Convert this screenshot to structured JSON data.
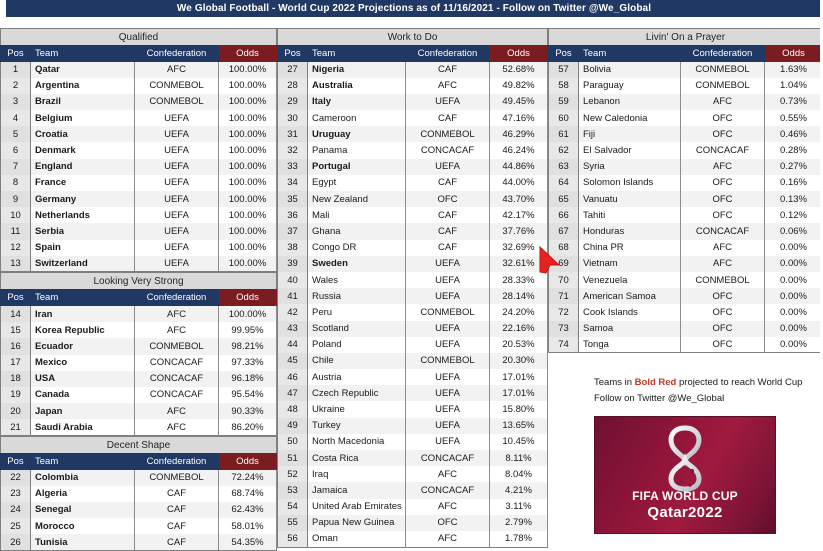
{
  "window": {
    "title": "We Global Football - World Cup 2022 Projections as of 11/16/2021 - Follow on Twitter @We_Global",
    "accent_navy": "#1F3864",
    "accent_red": "#7B1D20",
    "qualify_red": "#C0392B"
  },
  "columns": {
    "headers": {
      "pos": "Pos",
      "team": "Team",
      "confederation": "Confederation",
      "odds": "Odds"
    }
  },
  "sections": [
    {
      "band": "Qualified",
      "column": 1,
      "rows": [
        {
          "pos": "1",
          "team": "Qatar",
          "conf": "AFC",
          "odds": "100.00%",
          "bold": true
        },
        {
          "pos": "2",
          "team": "Argentina",
          "conf": "CONMEBOL",
          "odds": "100.00%",
          "bold": true
        },
        {
          "pos": "3",
          "team": "Brazil",
          "conf": "CONMEBOL",
          "odds": "100.00%",
          "bold": true
        },
        {
          "pos": "4",
          "team": "Belgium",
          "conf": "UEFA",
          "odds": "100.00%",
          "bold": true
        },
        {
          "pos": "5",
          "team": "Croatia",
          "conf": "UEFA",
          "odds": "100.00%",
          "bold": true
        },
        {
          "pos": "6",
          "team": "Denmark",
          "conf": "UEFA",
          "odds": "100.00%",
          "bold": true
        },
        {
          "pos": "7",
          "team": "England",
          "conf": "UEFA",
          "odds": "100.00%",
          "bold": true
        },
        {
          "pos": "8",
          "team": "France",
          "conf": "UEFA",
          "odds": "100.00%",
          "bold": true
        },
        {
          "pos": "9",
          "team": "Germany",
          "conf": "UEFA",
          "odds": "100.00%",
          "bold": true
        },
        {
          "pos": "10",
          "team": "Netherlands",
          "conf": "UEFA",
          "odds": "100.00%",
          "bold": true
        },
        {
          "pos": "11",
          "team": "Serbia",
          "conf": "UEFA",
          "odds": "100.00%",
          "bold": true
        },
        {
          "pos": "12",
          "team": "Spain",
          "conf": "UEFA",
          "odds": "100.00%",
          "bold": true
        },
        {
          "pos": "13",
          "team": "Switzerland",
          "conf": "UEFA",
          "odds": "100.00%",
          "bold": true
        }
      ]
    },
    {
      "band": "Looking Very Strong",
      "column": 1,
      "rows": [
        {
          "pos": "14",
          "team": "Iran",
          "conf": "AFC",
          "odds": "100.00%",
          "bold": true
        },
        {
          "pos": "15",
          "team": "Korea Republic",
          "conf": "AFC",
          "odds": "99.95%",
          "bold": true
        },
        {
          "pos": "16",
          "team": "Ecuador",
          "conf": "CONMEBOL",
          "odds": "98.21%",
          "bold": true
        },
        {
          "pos": "17",
          "team": "Mexico",
          "conf": "CONCACAF",
          "odds": "97.33%",
          "bold": true
        },
        {
          "pos": "18",
          "team": "USA",
          "conf": "CONCACAF",
          "odds": "96.18%",
          "bold": true
        },
        {
          "pos": "19",
          "team": "Canada",
          "conf": "CONCACAF",
          "odds": "95.54%",
          "bold": true
        },
        {
          "pos": "20",
          "team": "Japan",
          "conf": "AFC",
          "odds": "90.33%",
          "bold": true
        },
        {
          "pos": "21",
          "team": "Saudi Arabia",
          "conf": "AFC",
          "odds": "86.20%",
          "bold": true
        }
      ]
    },
    {
      "band": "Decent Shape",
      "column": 1,
      "rows": [
        {
          "pos": "22",
          "team": "Colombia",
          "conf": "CONMEBOL",
          "odds": "72.24%",
          "bold": true
        },
        {
          "pos": "23",
          "team": "Algeria",
          "conf": "CAF",
          "odds": "68.74%",
          "bold": true
        },
        {
          "pos": "24",
          "team": "Senegal",
          "conf": "CAF",
          "odds": "62.43%",
          "bold": true
        },
        {
          "pos": "25",
          "team": "Morocco",
          "conf": "CAF",
          "odds": "58.01%",
          "bold": true
        },
        {
          "pos": "26",
          "team": "Tunisia",
          "conf": "CAF",
          "odds": "54.35%",
          "bold": true
        }
      ]
    },
    {
      "band": "Work to Do",
      "column": 2,
      "rows": [
        {
          "pos": "27",
          "team": "Nigeria",
          "conf": "CAF",
          "odds": "52.68%",
          "bold": true
        },
        {
          "pos": "28",
          "team": "Australia",
          "conf": "AFC",
          "odds": "49.82%",
          "bold": true
        },
        {
          "pos": "29",
          "team": "Italy",
          "conf": "UEFA",
          "odds": "49.45%",
          "bold": true
        },
        {
          "pos": "30",
          "team": "Cameroon",
          "conf": "CAF",
          "odds": "47.16%",
          "bold": false
        },
        {
          "pos": "31",
          "team": "Uruguay",
          "conf": "CONMEBOL",
          "odds": "46.29%",
          "bold": true
        },
        {
          "pos": "32",
          "team": "Panama",
          "conf": "CONCACAF",
          "odds": "46.24%",
          "bold": false
        },
        {
          "pos": "33",
          "team": "Portugal",
          "conf": "UEFA",
          "odds": "44.86%",
          "bold": true
        },
        {
          "pos": "34",
          "team": "Egypt",
          "conf": "CAF",
          "odds": "44.00%",
          "bold": false
        },
        {
          "pos": "35",
          "team": "New Zealand",
          "conf": "OFC",
          "odds": "43.70%",
          "bold": false
        },
        {
          "pos": "36",
          "team": "Mali",
          "conf": "CAF",
          "odds": "42.17%",
          "bold": false
        },
        {
          "pos": "37",
          "team": "Ghana",
          "conf": "CAF",
          "odds": "37.76%",
          "bold": false
        },
        {
          "pos": "38",
          "team": "Congo DR",
          "conf": "CAF",
          "odds": "32.69%",
          "bold": false
        },
        {
          "pos": "39",
          "team": "Sweden",
          "conf": "UEFA",
          "odds": "32.61%",
          "bold": true
        },
        {
          "pos": "40",
          "team": "Wales",
          "conf": "UEFA",
          "odds": "28.33%",
          "bold": false
        },
        {
          "pos": "41",
          "team": "Russia",
          "conf": "UEFA",
          "odds": "28.14%",
          "bold": false
        },
        {
          "pos": "42",
          "team": "Peru",
          "conf": "CONMEBOL",
          "odds": "24.20%",
          "bold": false
        },
        {
          "pos": "43",
          "team": "Scotland",
          "conf": "UEFA",
          "odds": "22.16%",
          "bold": false
        },
        {
          "pos": "44",
          "team": "Poland",
          "conf": "UEFA",
          "odds": "20.53%",
          "bold": false
        },
        {
          "pos": "45",
          "team": "Chile",
          "conf": "CONMEBOL",
          "odds": "20.30%",
          "bold": false
        },
        {
          "pos": "46",
          "team": "Austria",
          "conf": "UEFA",
          "odds": "17.01%",
          "bold": false
        },
        {
          "pos": "47",
          "team": "Czech Republic",
          "conf": "UEFA",
          "odds": "17.01%",
          "bold": false
        },
        {
          "pos": "48",
          "team": "Ukraine",
          "conf": "UEFA",
          "odds": "15.80%",
          "bold": false
        },
        {
          "pos": "49",
          "team": "Turkey",
          "conf": "UEFA",
          "odds": "13.65%",
          "bold": false
        },
        {
          "pos": "50",
          "team": "North Macedonia",
          "conf": "UEFA",
          "odds": "10.45%",
          "bold": false
        },
        {
          "pos": "51",
          "team": "Costa Rica",
          "conf": "CONCACAF",
          "odds": "8.11%",
          "bold": false
        },
        {
          "pos": "52",
          "team": "Iraq",
          "conf": "AFC",
          "odds": "8.04%",
          "bold": false
        },
        {
          "pos": "53",
          "team": "Jamaica",
          "conf": "CONCACAF",
          "odds": "4.21%",
          "bold": false
        },
        {
          "pos": "54",
          "team": "United Arab Emirates",
          "conf": "AFC",
          "odds": "3.11%",
          "bold": false
        },
        {
          "pos": "55",
          "team": "Papua New Guinea",
          "conf": "OFC",
          "odds": "2.79%",
          "bold": false
        },
        {
          "pos": "56",
          "team": "Oman",
          "conf": "AFC",
          "odds": "1.78%",
          "bold": false
        }
      ]
    },
    {
      "band": "Livin' On a Prayer",
      "column": 3,
      "rows": [
        {
          "pos": "57",
          "team": "Bolivia",
          "conf": "CONMEBOL",
          "odds": "1.63%",
          "bold": false
        },
        {
          "pos": "58",
          "team": "Paraguay",
          "conf": "CONMEBOL",
          "odds": "1.04%",
          "bold": false
        },
        {
          "pos": "59",
          "team": "Lebanon",
          "conf": "AFC",
          "odds": "0.73%",
          "bold": false
        },
        {
          "pos": "60",
          "team": "New Caledonia",
          "conf": "OFC",
          "odds": "0.55%",
          "bold": false
        },
        {
          "pos": "61",
          "team": "Fiji",
          "conf": "OFC",
          "odds": "0.46%",
          "bold": false
        },
        {
          "pos": "62",
          "team": "El Salvador",
          "conf": "CONCACAF",
          "odds": "0.28%",
          "bold": false
        },
        {
          "pos": "63",
          "team": "Syria",
          "conf": "AFC",
          "odds": "0.27%",
          "bold": false
        },
        {
          "pos": "64",
          "team": "Solomon Islands",
          "conf": "OFC",
          "odds": "0.16%",
          "bold": false
        },
        {
          "pos": "65",
          "team": "Vanuatu",
          "conf": "OFC",
          "odds": "0.13%",
          "bold": false
        },
        {
          "pos": "66",
          "team": "Tahiti",
          "conf": "OFC",
          "odds": "0.12%",
          "bold": false
        },
        {
          "pos": "67",
          "team": "Honduras",
          "conf": "CONCACAF",
          "odds": "0.06%",
          "bold": false
        },
        {
          "pos": "68",
          "team": "China PR",
          "conf": "AFC",
          "odds": "0.00%",
          "bold": false
        },
        {
          "pos": "69",
          "team": "Vietnam",
          "conf": "AFC",
          "odds": "0.00%",
          "bold": false
        },
        {
          "pos": "70",
          "team": "Venezuela",
          "conf": "CONMEBOL",
          "odds": "0.00%",
          "bold": false
        },
        {
          "pos": "71",
          "team": "American Samoa",
          "conf": "OFC",
          "odds": "0.00%",
          "bold": false
        },
        {
          "pos": "72",
          "team": "Cook Islands",
          "conf": "OFC",
          "odds": "0.00%",
          "bold": false
        },
        {
          "pos": "73",
          "team": "Samoa",
          "conf": "OFC",
          "odds": "0.00%",
          "bold": false
        },
        {
          "pos": "74",
          "team": "Tonga",
          "conf": "OFC",
          "odds": "0.00%",
          "bold": false
        }
      ]
    }
  ],
  "notes": {
    "legend_prefix": "Teams in ",
    "legend_bold": "Bold Red",
    "legend_suffix": " projected to reach World Cup",
    "twitter": "Follow on Twitter @We_Global"
  },
  "logo": {
    "line1": "FIFA WORLD CUP",
    "line2": "Qatar2022"
  }
}
